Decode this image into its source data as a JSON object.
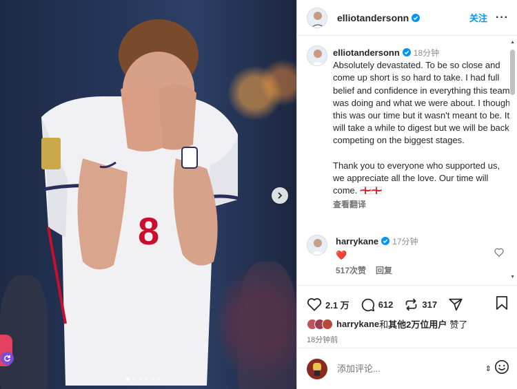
{
  "post": {
    "username": "elliotandersonn",
    "follow_label": "关注",
    "more_label": "···"
  },
  "caption": {
    "username": "elliotandersonn",
    "time": "18分钟",
    "paragraph1": "Absolutely devastated. To be so close and come up short is so hard to take. I had full belief and confidence in everything this team was doing and what we were about. I thought this was our time but it wasn't meant to be. It will take a while to digest but we will be back competing on the biggest stages.",
    "paragraph2": "Thank you to everyone who supported us, we appreciate all the love. Our time will come. 🏴󠁧󠁢󠁥󠁮󠁧󠁿🏴󠁧󠁢󠁥󠁮󠁧󠁿",
    "translate_label": "查看翻译"
  },
  "reply": {
    "username": "harrykane",
    "time": "17分钟",
    "text": "❤️",
    "likes_label": "517次赞",
    "reply_label": "回复"
  },
  "actions": {
    "like_count": "2.1 万",
    "comment_count": "612",
    "repost_count": "317"
  },
  "likes_summary": {
    "user": "harrykane",
    "connector": "和",
    "others": "其他2万位用户",
    "suffix": "赞了"
  },
  "post_time": "18分钟前",
  "comment_box": {
    "placeholder": "添加评论..."
  },
  "carousel": {
    "count": 6,
    "active_index": 0
  },
  "colors": {
    "accent_blue": "#0095f6",
    "verified_blue": "#0095f6",
    "heart_red": "#ed4956"
  }
}
